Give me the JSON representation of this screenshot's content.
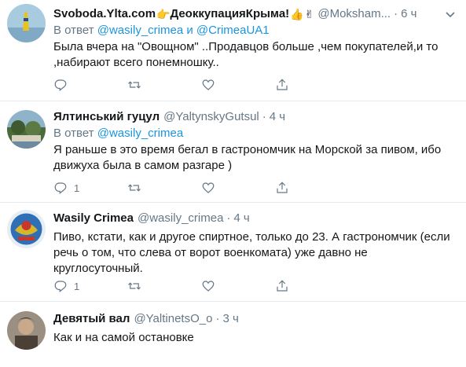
{
  "tweets": [
    {
      "name": "Svoboda.Ylta.com",
      "name_suffix": "ДеоккупацияКрыма!",
      "handle": "@Moksham...",
      "time": "6 ч",
      "reply_prefix": "В ответ",
      "reply_link1": "@wasily_crimea",
      "reply_and": "и",
      "reply_link2": "@CrimeaUA1",
      "text": "Была вчера на \"Овощном\" ..Продавцов больше ,чем покупателей,и  то ,набирают всего понемношку..",
      "reply_count": "",
      "retweet_count": "",
      "like_count": ""
    },
    {
      "name": "Ялтинський гуцул",
      "handle": "@YaltynskyGutsul",
      "time": "4 ч",
      "reply_prefix": "В ответ",
      "reply_link1": "@wasily_crimea",
      "text": "Я раньше в это время бегал в гастрономчик на Морской за пивом, ибо движуха была в самом разгаре )",
      "reply_count": "1",
      "retweet_count": "",
      "like_count": ""
    },
    {
      "name": "Wasily Crimea",
      "handle": "@wasily_crimea",
      "time": "4 ч",
      "text": "Пиво, кстати, как и другое спиртное, только до 23. А гастрономчик (если речь о том, что слева от ворот военкомата) уже давно не круглосуточный.",
      "reply_count": "1",
      "retweet_count": "",
      "like_count": ""
    },
    {
      "name": "Девятый вал",
      "handle": "@YaltinetsO_o",
      "time": "3 ч",
      "text": "Как и на самой остановке"
    }
  ],
  "icons": {
    "reply": "reply-icon",
    "retweet": "retweet-icon",
    "like": "heart-icon",
    "share": "share-icon",
    "caret": "chevron-down-icon"
  },
  "colors": {
    "link": "#1b95e0",
    "muted": "#657786",
    "text": "#14171a",
    "divider": "#e6ecf0"
  }
}
